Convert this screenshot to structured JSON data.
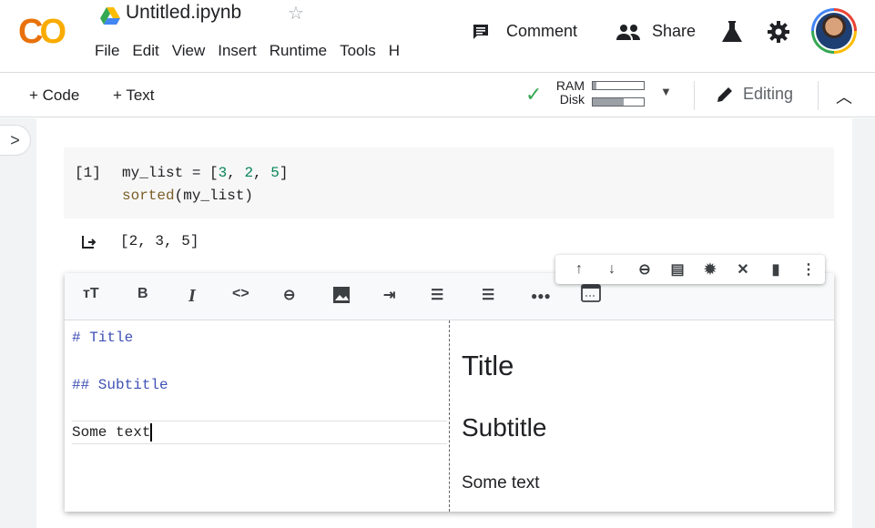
{
  "header": {
    "logo_text": "CO",
    "notebook_title": "Untitled.ipynb",
    "star_icon": "star-icon",
    "menu": [
      "File",
      "Edit",
      "View",
      "Insert",
      "Runtime",
      "Tools",
      "H"
    ],
    "comment_label": "Comment",
    "share_label": "Share",
    "colors": {
      "logo_orange": "#e8710a",
      "logo_yellow": "#f9ab00"
    }
  },
  "toolbar": {
    "add_code_label": "+ Code",
    "add_text_label": "+ Text",
    "ram_label": "RAM",
    "disk_label": "Disk",
    "ram_usage": 0.08,
    "disk_usage": 0.6,
    "editing_label": "Editing",
    "connected_color": "#34a853"
  },
  "code_cell": {
    "exec_count": "[1]",
    "line1_prefix": "my_list = [",
    "line1_nums": [
      "3",
      "2",
      "5"
    ],
    "line1_suffix": "]",
    "line2_fn": "sorted",
    "line2_rest": "(my_list)",
    "output": "[2, 3, 5]"
  },
  "text_cell": {
    "editor_lines": [
      "# Title",
      "## Subtitle",
      "Some text"
    ],
    "preview_title": "Title",
    "preview_subtitle": "Subtitle",
    "preview_text": "Some text",
    "format_tools": [
      "TT",
      "B",
      "I",
      "<>",
      "link",
      "image",
      "indent",
      "numbered-list",
      "bulleted-list",
      "horizontal-rule",
      "toggle-preview"
    ]
  },
  "cell_toolbar": [
    "move-up",
    "move-down",
    "link",
    "comment",
    "settings",
    "mirror",
    "delete",
    "more"
  ]
}
